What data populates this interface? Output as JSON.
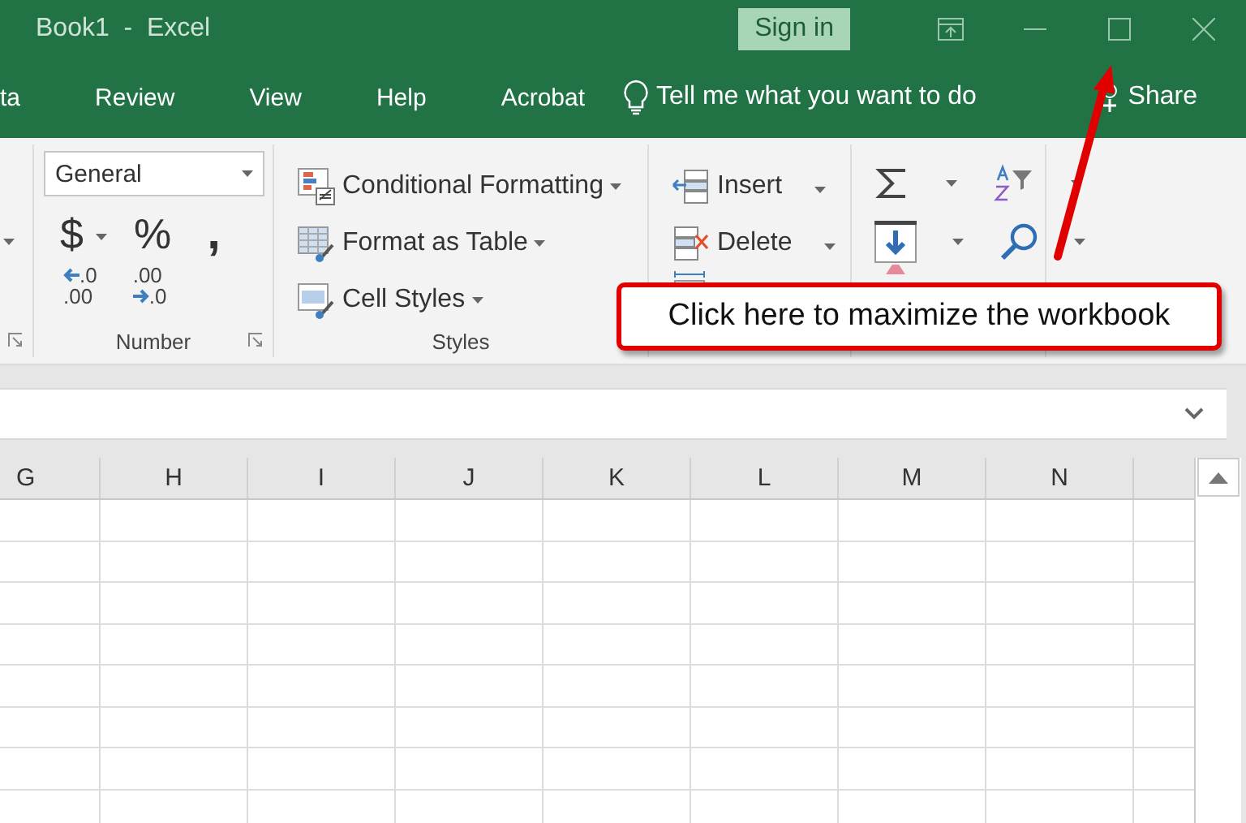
{
  "window": {
    "title": "Book1  -  Excel",
    "sign_in": "Sign in"
  },
  "tabs": [
    {
      "label": "ta"
    },
    {
      "label": "Review"
    },
    {
      "label": "View"
    },
    {
      "label": "Help"
    },
    {
      "label": "Acrobat"
    }
  ],
  "tell_me": "Tell me what you want to do",
  "share": "Share",
  "number_group": {
    "format": "General",
    "currency": "$",
    "percent": "%",
    "comma": ",",
    "increase_decimal": {
      "top": ".0",
      "bottom": ".00"
    },
    "decrease_decimal": {
      "top": ".00",
      "bottom": ".0"
    },
    "label": "Number"
  },
  "styles_group": {
    "items": [
      {
        "kind": "conditional",
        "label": "Conditional Formatting"
      },
      {
        "kind": "table",
        "label": "Format as Table"
      },
      {
        "kind": "cell",
        "label": "Cell Styles"
      }
    ],
    "label": "Styles"
  },
  "cells_group": {
    "items": [
      {
        "kind": "insert",
        "label": "Insert"
      },
      {
        "kind": "delete",
        "label": "Delete"
      }
    ]
  },
  "columns": [
    "G",
    "H",
    "I",
    "J",
    "K",
    "L",
    "M",
    "N"
  ],
  "callout": "Click here to maximize the workbook"
}
